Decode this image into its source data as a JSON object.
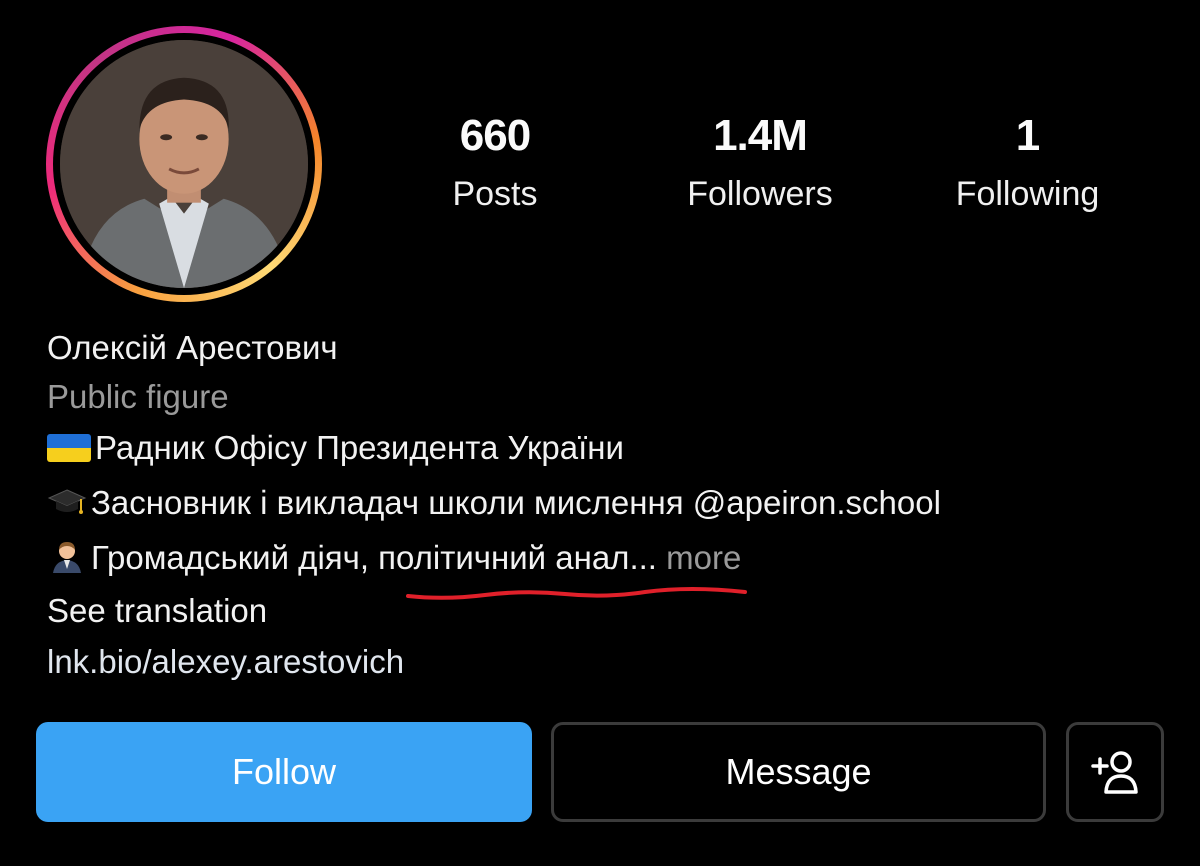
{
  "profile": {
    "name": "Олексій Арестович",
    "category": "Public figure",
    "bio": {
      "line1": "Радник Офісу Президента України",
      "line2_prefix": "Засновник і викладач школи мислення ",
      "line2_mention": "@apeiron.school",
      "line3_text": "Громадський діяч, політичний анал...",
      "line3_more": " more",
      "translate": "See translation",
      "link": "lnk.bio/alexey.arestovich"
    },
    "icons": {
      "line1": "ukraine-flag-icon",
      "line2": "graduation-cap-icon",
      "line3": "man-office-worker-icon"
    }
  },
  "stats": {
    "posts": {
      "value": "660",
      "label": "Posts"
    },
    "followers": {
      "value": "1.4M",
      "label": "Followers"
    },
    "following": {
      "value": "1",
      "label": "Following"
    }
  },
  "actions": {
    "follow_label": "Follow",
    "message_label": "Message",
    "add_user_icon": "add-user-icon"
  },
  "colors": {
    "background": "#000000",
    "follow_button": "#3aa3f4",
    "secondary_text": "#9a9a9a",
    "annotation_underline": "#e0202a"
  }
}
